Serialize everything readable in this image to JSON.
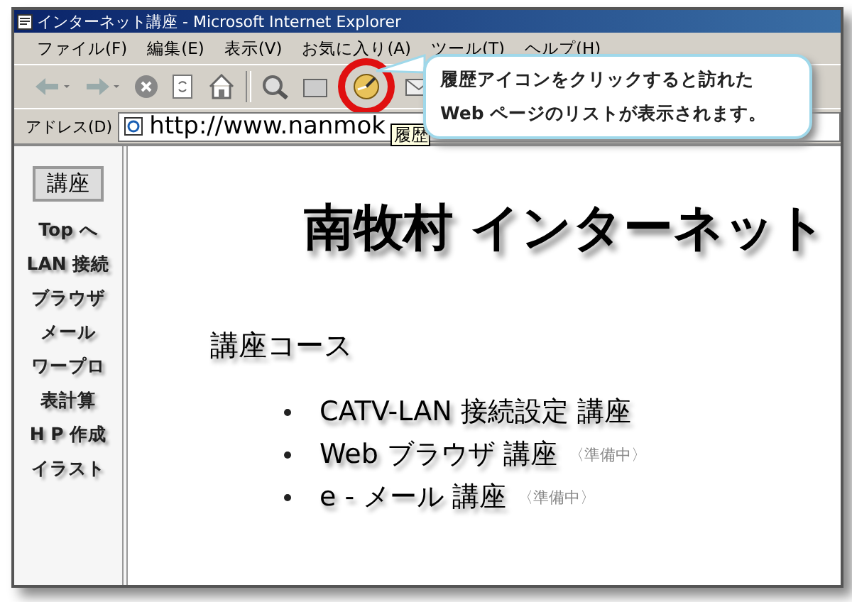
{
  "window": {
    "title": "インターネット講座 - Microsoft Internet Explorer"
  },
  "menu": [
    "ファイル(F)",
    "編集(E)",
    "表示(V)",
    "お気に入り(A)",
    "ツール(T)",
    "ヘルプ(H)"
  ],
  "toolbar": [
    {
      "kind": "back",
      "highlighted": false
    },
    {
      "kind": "forward",
      "highlighted": false
    },
    {
      "kind": "stop",
      "highlighted": false
    },
    {
      "kind": "refresh",
      "highlighted": false
    },
    {
      "kind": "home",
      "highlighted": false
    },
    {
      "kind": "search",
      "highlighted": false
    },
    {
      "kind": "favorites",
      "highlighted": false
    },
    {
      "kind": "history",
      "highlighted": true
    },
    {
      "kind": "mail",
      "highlighted": false
    }
  ],
  "address": {
    "label": "アドレス(D)",
    "value": "http://www.nanmok"
  },
  "tooltip": "履歴",
  "callout": {
    "lines": [
      "履歴アイコンをクリックすると訪れた",
      "Web ページのリストが表示されます。"
    ]
  },
  "sidebar": {
    "header": "講座",
    "items": [
      "Top へ",
      "LAN 接続",
      "ブラウザ",
      "メール",
      "ワープロ",
      "表計算",
      "H P 作成",
      "イラスト"
    ]
  },
  "page": {
    "title": "南牧村 インターネット",
    "section": "講座コース",
    "courses": [
      {
        "name": "CATV-LAN 接続設定 講座"
      },
      {
        "name": "Web ブラウザ 講座",
        "note": "〈準備中〉"
      },
      {
        "name": "e - メール 講座",
        "note": "〈準備中〉"
      }
    ]
  }
}
